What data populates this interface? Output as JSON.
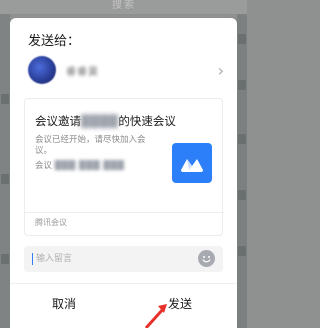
{
  "background": {
    "search_hint": "搜索"
  },
  "dialog": {
    "title": "发送给：",
    "recipient": {
      "name": "睿睿昊"
    },
    "card": {
      "title_prefix": "会议邀请",
      "title_blurred": "████",
      "title_suffix": "的快速会议",
      "description": "会议已经开始，请尽快加入会议。",
      "code_label": "会议",
      "code_blurred": "███ ███ ███",
      "source": "腾讯会议",
      "logo_color": "#2d7ff9"
    },
    "message": {
      "placeholder": "输入留言"
    },
    "buttons": {
      "cancel": "取消",
      "send": "发送"
    }
  },
  "colors": {
    "accent": "#2f7cf6",
    "overlay": "#8f9090",
    "annotation_arrow": "#e8302a"
  }
}
